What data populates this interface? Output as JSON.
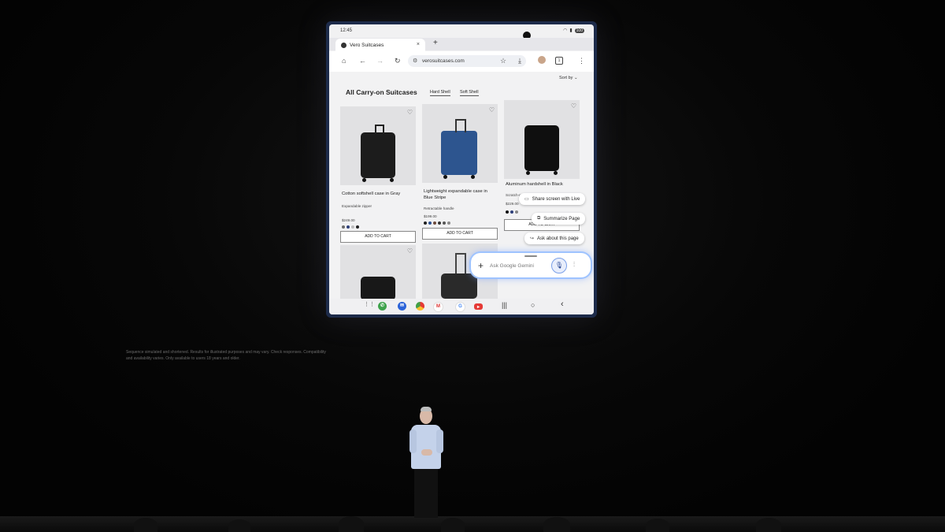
{
  "status": {
    "time": "12:45",
    "battery": "100"
  },
  "tab": {
    "title": "Vero Suitcases",
    "close": "×",
    "new": "+"
  },
  "toolbar": {
    "home_icon": "⌂",
    "back_icon": "←",
    "forward_icon": "→",
    "reload_icon": "↻",
    "url": "verosuitcases.com",
    "tune_icon": "⚙",
    "bookmark_icon": "☆",
    "download_icon": "⤓",
    "tab_count": "1",
    "menu_icon": "⋮"
  },
  "page": {
    "sort_label": "Sort by ⌄",
    "title": "All Carry-on Suitcases",
    "filters": [
      "Hard Shell",
      "Soft Shell"
    ]
  },
  "products": [
    {
      "name": "Cotton softshell case in Gray",
      "feature": "Expandable zipper",
      "price": "$249.00",
      "cart_label": "ADD TO CART",
      "swatches": [
        "#6b6b6b",
        "#2d3f7a",
        "#bdbdbd",
        "#222222"
      ]
    },
    {
      "name": "Lightweight expandable case in Blue Stripe",
      "feature": "Retractable handle",
      "price": "$199.00",
      "cart_label": "ADD TO CART",
      "swatches": [
        "#1e1e1e",
        "#2a4f8f",
        "#6e4a3b",
        "#333333",
        "#555555",
        "#8a8a8a"
      ]
    },
    {
      "name": "Aluminum hardshell in Black",
      "feature": "Scratch-resistant",
      "price": "$229.00",
      "cart_label": "ADD TO CART",
      "swatches": [
        "#111111",
        "#2d3f7a",
        "#888888"
      ]
    }
  ],
  "gemini": {
    "suggestions": [
      {
        "label": "Share screen with Live",
        "icon": "screen-share-icon"
      },
      {
        "label": "Summarize Page",
        "icon": "summarize-icon"
      },
      {
        "label": "Ask about this page",
        "icon": "reply-icon"
      }
    ],
    "placeholder": "Ask Google Gemini",
    "plus_icon": "+",
    "mic_icon": "🎙",
    "live_icon": "⫶"
  },
  "nav": {
    "recents": "|||",
    "home": "○",
    "back": "‹",
    "apps": "⋮⋮"
  },
  "disclaimer": "Sequence simulated and shortened. Results for illustrated purposes and may vary. Check responses. Compatibility and availability varies. Only available to users 18 years and older.",
  "colors": {
    "gemini_glow": "#9ec3ff",
    "device_frame": "#1d2b4a"
  }
}
